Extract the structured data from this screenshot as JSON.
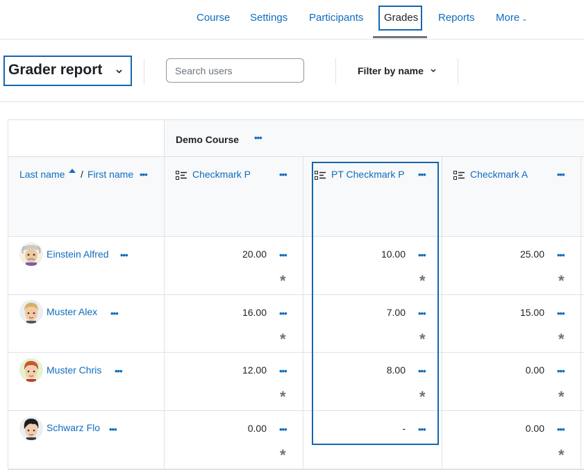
{
  "nav": {
    "items": [
      "Course",
      "Settings",
      "Participants",
      "Grades",
      "Reports",
      "More"
    ],
    "active": "Grades"
  },
  "toolbar": {
    "report_title": "Grader report",
    "search_placeholder": "Search users",
    "filter_label": "Filter by name"
  },
  "table": {
    "course_name": "Demo Course",
    "name_header": {
      "last": "Last name",
      "separator": "/",
      "first": "First name"
    },
    "columns": [
      "Checkmark P",
      "PT Checkmark P",
      "Checkmark A"
    ],
    "rows": [
      {
        "name": "Einstein Alfred",
        "grades": [
          "20.00",
          "10.00",
          "25.00"
        ]
      },
      {
        "name": "Muster Alex",
        "grades": [
          "16.00",
          "7.00",
          "15.00"
        ]
      },
      {
        "name": "Muster Chris",
        "grades": [
          "12.00",
          "8.00",
          "0.00"
        ]
      },
      {
        "name": "Schwarz Flo",
        "grades": [
          "0.00",
          "-",
          "0.00"
        ]
      }
    ]
  },
  "icons": {
    "actions": "more-horizontal-icon",
    "override": "asterisk-icon",
    "grade_item": "checklist-icon",
    "sort": "sort-ascending-icon"
  },
  "colors": {
    "link": "#0f6cbf",
    "highlight": "#1566b0"
  }
}
